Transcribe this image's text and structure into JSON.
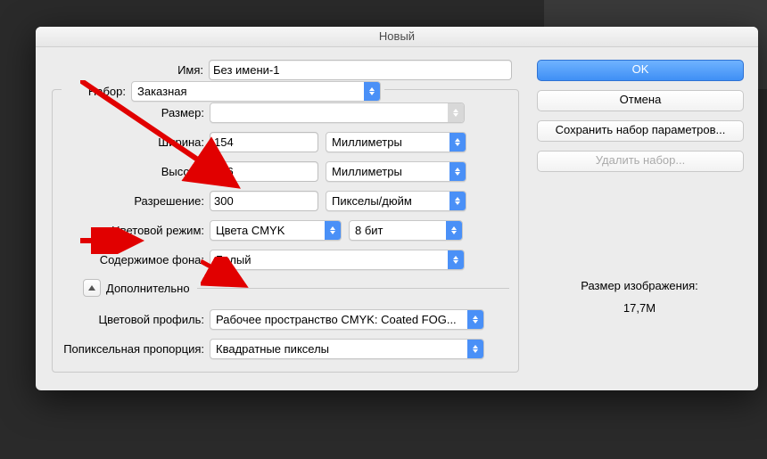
{
  "dialog": {
    "title": "Новый",
    "name_label": "Имя:",
    "name_value": "Без имени-1",
    "preset_label": "Набор:",
    "preset_value": "Заказная",
    "size_label": "Размер:",
    "size_value": "",
    "width_label": "Ширина:",
    "width_value": "154",
    "width_unit": "Миллиметры",
    "height_label": "Высота:",
    "height_value": "216",
    "height_unit": "Миллиметры",
    "resolution_label": "Разрешение:",
    "resolution_value": "300",
    "resolution_unit": "Пикселы/дюйм",
    "colormode_label": "Цветовой режим:",
    "colormode_value": "Цвета CMYK",
    "colormode_depth": "8 бит",
    "background_label": "Содержимое фона:",
    "background_value": "Белый",
    "advanced_label": "Дополнительно",
    "profile_label": "Цветовой профиль:",
    "profile_value": "Рабочее пространство CMYK:  Coated FOG...",
    "pixelaspect_label": "Попиксельная пропорция:",
    "pixelaspect_value": "Квадратные пикселы"
  },
  "buttons": {
    "ok": "OK",
    "cancel": "Отмена",
    "save_preset": "Сохранить набор параметров...",
    "delete_preset": "Удалить набор..."
  },
  "info": {
    "image_size_label": "Размер изображения:",
    "image_size_value": "17,7M"
  }
}
